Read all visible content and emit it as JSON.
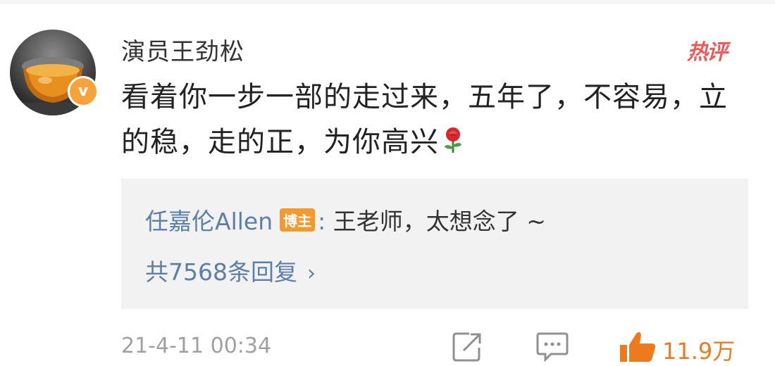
{
  "comment": {
    "username": "演员王劲松",
    "hot_badge": "热评",
    "verified_mark": "v",
    "text": "看着你一步一部的走过来，五年了，不容易，立的稳，走的正，为你高兴",
    "emoji": "rose-icon",
    "timestamp": "21-4-11 00:34",
    "likes": "11.9万"
  },
  "reply": {
    "author": "任嘉伦Allen",
    "badge": "博主",
    "separator": ": ",
    "text": "王老师，太想念了 ~",
    "count_label": "共7568条回复",
    "chevron": "›"
  },
  "actions": {
    "share_icon": "share-icon",
    "comment_icon": "comment-icon",
    "like_icon": "thumbs-up-icon"
  },
  "colors": {
    "link_blue": "#5d7ea8",
    "hot_red": "#ec5b5b",
    "like_orange": "#ee7a1f",
    "verified_orange": "#f7a23b",
    "reply_bg": "#f2f2f2",
    "meta_gray": "#a0a0a0"
  }
}
